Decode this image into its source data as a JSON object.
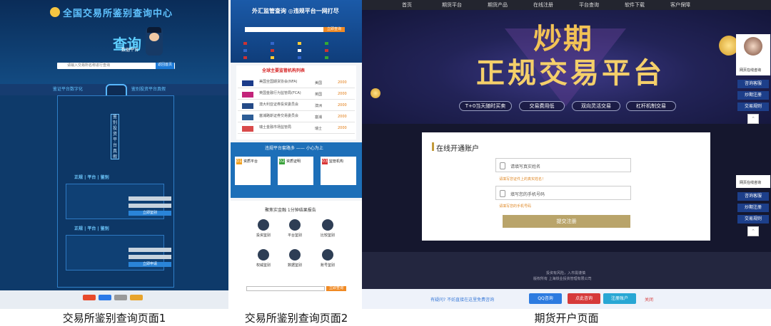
{
  "captions": {
    "panel1": "交易所鉴别查询页面1",
    "panel2": "交易所鉴别查询页面2",
    "panel3": "期货开户页面"
  },
  "panel1": {
    "title": "全国交易所鉴别查询中心",
    "big_word": "查询",
    "big_sub": "数据平台",
    "search_placeholder": "请输入交易所名称进行查询",
    "search_button": "返回首页",
    "band_text": "鉴证平台数字化",
    "band_text2": "鉴别投资平台真假",
    "vertical_text": "鉴别投资平台真假",
    "section1": "正规 | 平台 | 鉴别",
    "section2": "正规 | 平台 | 鉴别",
    "form_button": "立即鉴别",
    "form_button2": "立即申请"
  },
  "panel2": {
    "title": "外汇监管查询",
    "title2": "◎违规平台一网打尽",
    "search_button": "立即查询",
    "list_title": "全球主要监管机构列表",
    "regulators": [
      {
        "name": "美国全国期货协会(NFA)",
        "country": "美国",
        "year": "2000"
      },
      {
        "name": "英国金融行为监管局(FCA)",
        "country": "英国",
        "year": "2000"
      },
      {
        "name": "澳大利亚证券投资委员会",
        "country": "澳洲",
        "year": "2000"
      },
      {
        "name": "塞浦路斯证券交易委员会",
        "country": "塞浦",
        "year": "2000"
      },
      {
        "name": "瑞士金融市场监管局",
        "country": "瑞士",
        "year": "2000"
      }
    ],
    "section_title": "违规平台套路多 —— 小心为上",
    "cards": [
      {
        "num": "01",
        "head": "资质平台"
      },
      {
        "num": "02",
        "head": "资质证明"
      },
      {
        "num": "03",
        "head": "监管机构"
      }
    ],
    "results_title": "聚焦实金融 1分钟结果报告",
    "icons": [
      "投资鉴别",
      "平台鉴别",
      "比较鉴别",
      "权威鉴别",
      "数据鉴别",
      "账号鉴别"
    ],
    "bottom_button": "立即查询"
  },
  "panel3": {
    "nav": [
      "首页",
      "期货平台",
      "期货产品",
      "在线注册",
      "平台查询",
      "软件下载",
      "客户保障"
    ],
    "headline1": "炒期",
    "headline2": "正规交易平台",
    "tags": [
      "T+0当天随时买卖",
      "交易费用低",
      "双向灵活交易",
      "杠杆机制交易"
    ],
    "form_title": "在线开通账户",
    "name_placeholder": "请填写真实姓名",
    "name_hint": "请填写您证件上的真实姓名！",
    "phone_placeholder": "填写您的手机号码",
    "phone_hint": "请填写您的手机号码",
    "submit": "提交注册",
    "footer1": "投资有风险，入市需谨慎",
    "footer2": "版权所有 上海铁业投资管理有限公司",
    "bottom_hint": "有疑问? 不妨直接在这里免费咨询",
    "bottom_buttons": [
      "QQ咨询",
      "点此咨询",
      "注册账户"
    ],
    "close": "关闭",
    "side_label": "网页在线咨询",
    "side_buttons": [
      "咨询客服",
      "炒期注册",
      "交易规则"
    ]
  }
}
